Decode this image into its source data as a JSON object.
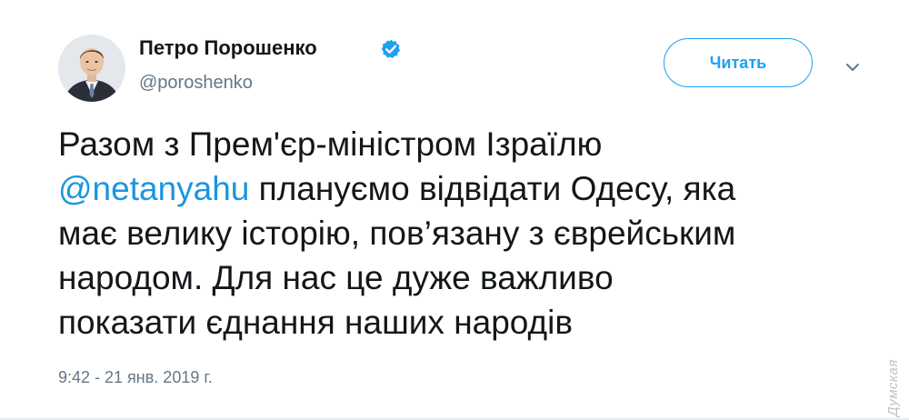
{
  "author": {
    "name": "Петро Порошенко",
    "handle": "@poroshenko",
    "verified": true
  },
  "follow_button": {
    "label": "Читать"
  },
  "tweet": {
    "lines": [
      [
        {
          "text": "Разом з Прем'єр-міністром Ізраїлю",
          "type": "text"
        }
      ],
      [
        {
          "text": "@netanyahu",
          "type": "mention"
        },
        {
          "text": " плануємо відвідати Одесу, яка",
          "type": "text"
        }
      ],
      [
        {
          "text": "має велику історію, пов’язану з єврейським",
          "type": "text"
        }
      ],
      [
        {
          "text": "народом. Для нас це дуже важливо",
          "type": "text"
        }
      ],
      [
        {
          "text": "показати єднання наших народів",
          "type": "text"
        }
      ]
    ]
  },
  "timestamp": "9:42 - 21 янв. 2019 г.",
  "watermark": "Думская",
  "colors": {
    "accent": "#1da1f2",
    "mention": "#1b95e0",
    "muted": "#657786",
    "text": "#14171a"
  },
  "icons": {
    "verified": "verified-badge-icon",
    "caret": "chevron-down-icon"
  }
}
